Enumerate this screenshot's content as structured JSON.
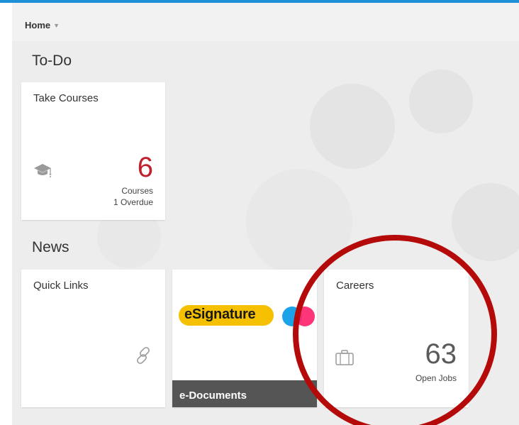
{
  "header": {
    "breadcrumb": "Home",
    "caret": "▼"
  },
  "sections": {
    "todo": "To-Do",
    "news": "News"
  },
  "tiles": {
    "courses": {
      "title": "Take Courses",
      "count": "6",
      "label": "Courses",
      "overdue": "1 Overdue",
      "icon": "graduation-cap-icon"
    },
    "quick_links": {
      "title": "Quick Links",
      "icon": "link-icon"
    },
    "documents": {
      "logo_text": "eSignature",
      "footer": "e-Documents",
      "dot_colors": [
        "#1aa3e8",
        "#ff1f6a"
      ]
    },
    "careers": {
      "title": "Careers",
      "count": "63",
      "label": "Open Jobs",
      "icon": "briefcase-icon"
    }
  },
  "colors": {
    "accent_bar": "#1e90d6",
    "overdue_count": "#c0202e",
    "annotation_circle": "#b50a0a",
    "logo_pill": "#f5c000"
  }
}
